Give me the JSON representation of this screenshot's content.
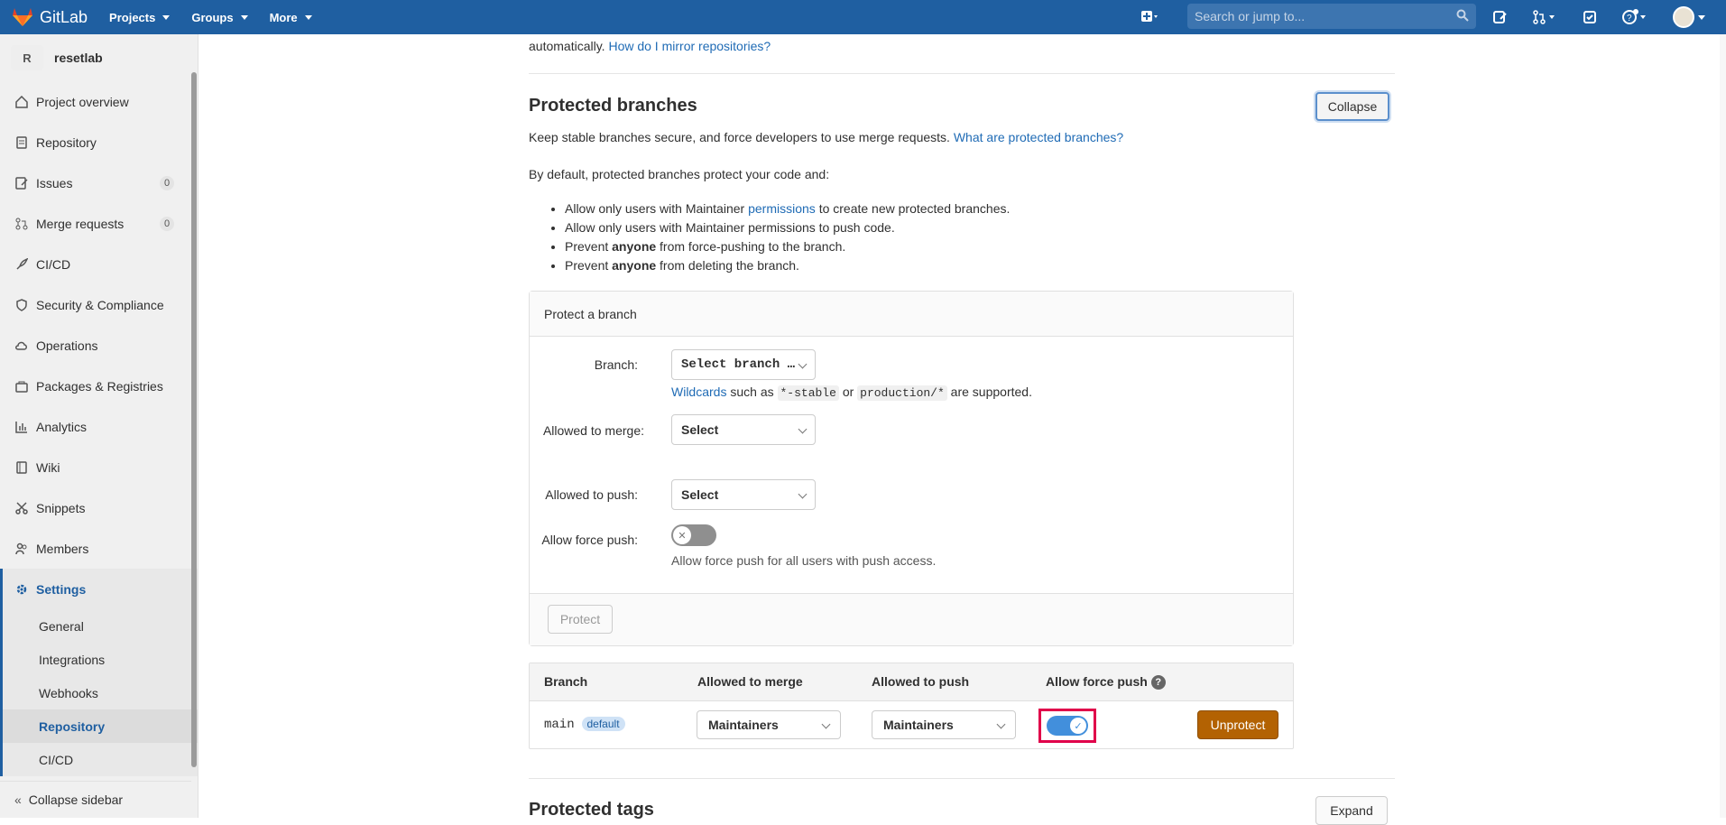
{
  "topbar": {
    "brand": "GitLab",
    "nav": [
      "Projects",
      "Groups",
      "More"
    ],
    "search_placeholder": "Search or jump to..."
  },
  "sidebar": {
    "project_initial": "R",
    "project_name": "resetlab",
    "items": [
      {
        "label": "Project overview",
        "icon": "home-icon"
      },
      {
        "label": "Repository",
        "icon": "doc-icon"
      },
      {
        "label": "Issues",
        "icon": "issues-icon",
        "count": "0"
      },
      {
        "label": "Merge requests",
        "icon": "merge-icon",
        "count": "0"
      },
      {
        "label": "CI/CD",
        "icon": "rocket-icon"
      },
      {
        "label": "Security & Compliance",
        "icon": "shield-icon"
      },
      {
        "label": "Operations",
        "icon": "cloud-icon"
      },
      {
        "label": "Packages & Registries",
        "icon": "package-icon"
      },
      {
        "label": "Analytics",
        "icon": "chart-icon"
      },
      {
        "label": "Wiki",
        "icon": "book-icon"
      },
      {
        "label": "Snippets",
        "icon": "scissors-icon"
      },
      {
        "label": "Members",
        "icon": "users-icon"
      }
    ],
    "settings_label": "Settings",
    "sub_items": [
      "General",
      "Integrations",
      "Webhooks",
      "Repository",
      "CI/CD"
    ],
    "active_sub": "Repository",
    "collapse_label": "Collapse sidebar"
  },
  "mirror": {
    "prefix": "automatically.",
    "link": "How do I mirror repositories?"
  },
  "protected_branches": {
    "title": "Protected branches",
    "collapse_label": "Collapse",
    "desc": "Keep stable branches secure, and force developers to use merge requests.",
    "desc_link": "What are protected branches?",
    "default_intro": "By default, protected branches protect your code and:",
    "rule1_a": "Allow only users with Maintainer",
    "rule1_link": "permissions",
    "rule1_b": "to create new protected branches.",
    "rule2": "Allow only users with Maintainer permissions to push code.",
    "rule3_a": "Prevent",
    "rule3_bold": "anyone",
    "rule3_b": "from force-pushing to the branch.",
    "rule4_a": "Prevent",
    "rule4_bold": "anyone",
    "rule4_b": "from deleting the branch."
  },
  "protect_form": {
    "header": "Protect a branch",
    "branch_label": "Branch:",
    "branch_select": "Select branch …",
    "wildcards_link": "Wildcards",
    "wildcards_text1": "such as",
    "wildcard1": "*-stable",
    "wildcards_or": "or",
    "wildcard2": "production/*",
    "wildcards_text2": "are supported.",
    "merge_label": "Allowed to merge:",
    "merge_select": "Select",
    "push_label": "Allowed to push:",
    "push_select": "Select",
    "force_label": "Allow force push:",
    "force_help": "Allow force push for all users with push access.",
    "protect_button": "Protect"
  },
  "table": {
    "headers": [
      "Branch",
      "Allowed to merge",
      "Allowed to push",
      "Allow force push"
    ],
    "rows": [
      {
        "branch": "main",
        "badge": "default",
        "merge": "Maintainers",
        "push": "Maintainers",
        "force_push": true,
        "action": "Unprotect"
      }
    ]
  },
  "protected_tags": {
    "title": "Protected tags",
    "expand_label": "Expand"
  }
}
